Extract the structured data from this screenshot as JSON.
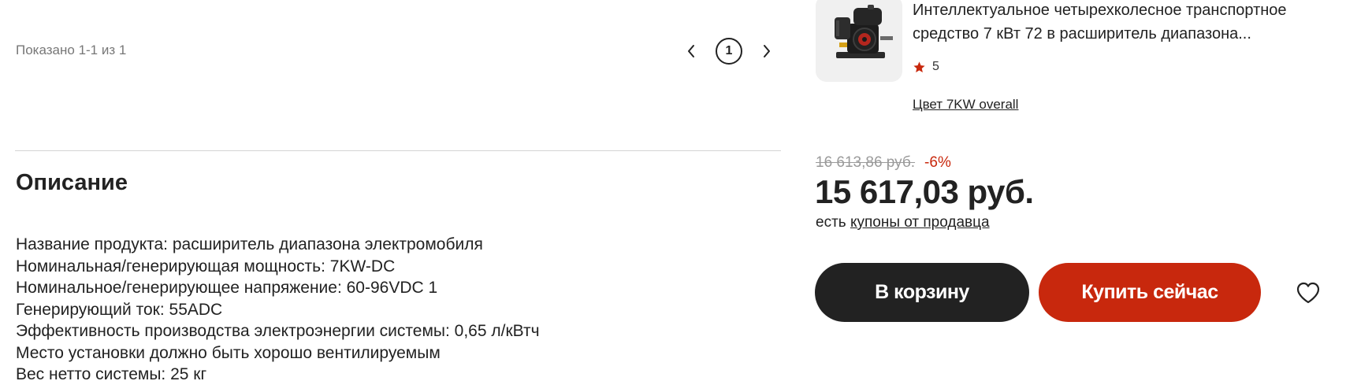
{
  "pagination": {
    "shown_text": "Показано 1-1 из 1",
    "prev_icon": "chevron-left-icon",
    "current_page": "1",
    "next_icon": "chevron-right-icon"
  },
  "description": {
    "title": "Описание",
    "lines": [
      "Название продукта: расширитель диапазона электромобиля",
      "Номинальная/генерирующая мощность: 7KW-DC",
      "Номинальное/генерирующее напряжение: 60-96VDC 1",
      "Генерирующий ток: 55ADC",
      "Эффективность производства электроэнергии системы: 0,65 л/кВтч",
      "Место установки должно быть хорошо вентилируемым",
      "Вес нетто системы: 25 кг"
    ]
  },
  "product": {
    "title": "Интеллектуальное четырехколесное транспортное средство 7 кВт 72 в расширитель диапазона...",
    "rating_icon": "star-icon",
    "rating_value": "5",
    "color_option": "Цвет 7KW overall",
    "old_price": "16 613,86 руб.",
    "discount": "-6%",
    "price": "15 617,03 руб.",
    "coupon_prefix": "есть",
    "coupon_link": "купоны от продавца"
  },
  "actions": {
    "cart_label": "В корзину",
    "buy_label": "Купить сейчас",
    "favorite_icon": "heart-icon"
  },
  "colors": {
    "accent_red": "#c8280d",
    "dark_button": "#222222",
    "muted_text": "#777777",
    "strike_price": "#9a9a9a"
  }
}
